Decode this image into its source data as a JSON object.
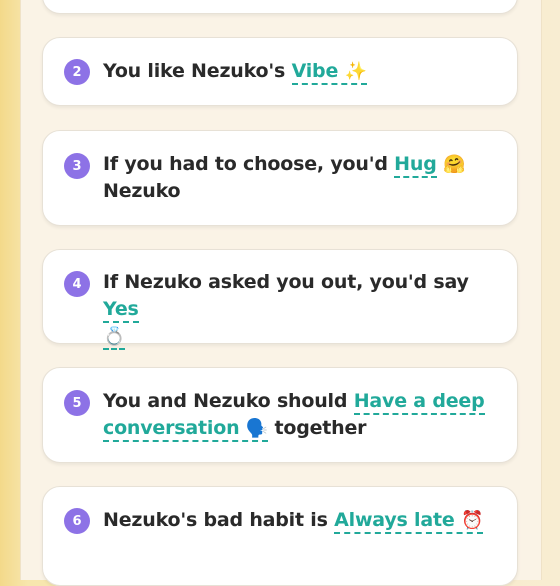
{
  "questions": [
    {
      "num": "2",
      "prefix": "You like Nezuko's ",
      "answer": "Vibe",
      "emoji": "✨",
      "suffix": ""
    },
    {
      "num": "3",
      "prefix": "If you had to choose, you'd ",
      "answer": "Hug",
      "emoji": "🤗",
      "suffix": "Nezuko"
    },
    {
      "num": "4",
      "prefix": "If Nezuko asked you out, you'd say ",
      "answer": "Yes",
      "emoji": "💍",
      "suffix": ""
    },
    {
      "num": "5",
      "prefix": "You and Nezuko should ",
      "answer": "Have a deep conversation",
      "emoji": "🗣️",
      "suffix": "together"
    },
    {
      "num": "6",
      "prefix": "Nezuko's bad habit is ",
      "answer": "Always late",
      "emoji": "⏰",
      "suffix": ""
    }
  ],
  "colors": {
    "accent_purple": "#8d72e6",
    "answer_teal": "#21a99a",
    "background_yellow": "#f3d98a"
  },
  "icons": [
    "sparkles-emoji",
    "hugging-face-emoji",
    "ring-emoji",
    "speaking-head-emoji",
    "alarm-clock-emoji"
  ]
}
